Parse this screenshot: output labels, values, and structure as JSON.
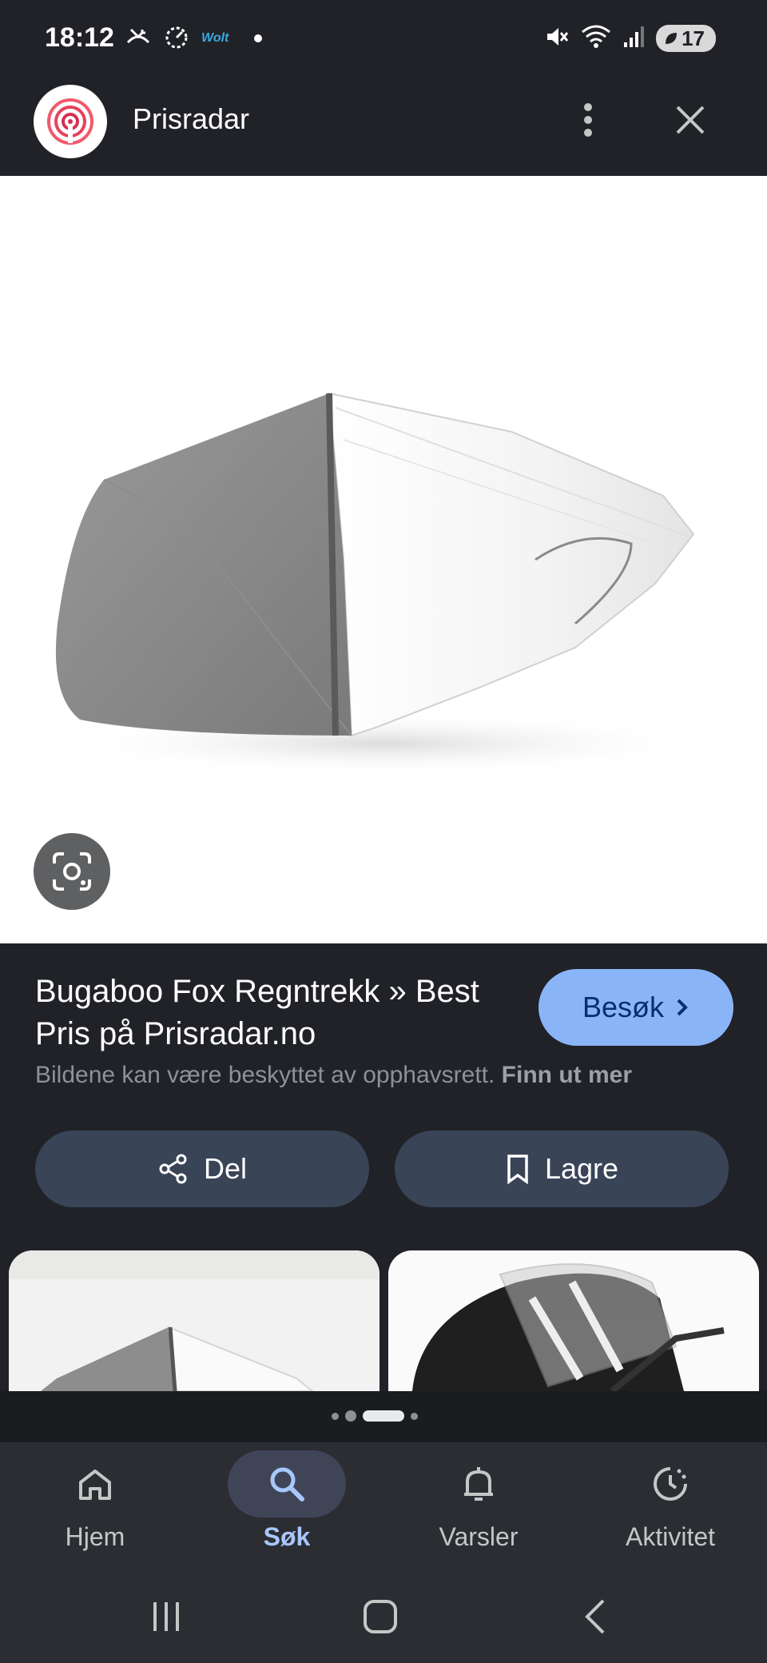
{
  "status_bar": {
    "time": "18:12",
    "left_icons": [
      "missed-call-icon",
      "timer-icon",
      "wolt-icon",
      "notification-dot"
    ],
    "wolt_label": "Wolt",
    "right_icons": [
      "mute-icon",
      "wifi-icon",
      "signal-icon"
    ],
    "battery": "17"
  },
  "header": {
    "app_name": "Prisradar",
    "more_icon": "more-vert-icon",
    "close_icon": "close-icon"
  },
  "result": {
    "title": "Bugaboo Fox Regntrekk » Best Pris på Prisradar.no",
    "visit_label": "Besøk",
    "copyright_text": "Bildene kan være beskyttet av opphavsrett.",
    "learn_more": "Finn ut mer",
    "share_label": "Del",
    "save_label": "Lagre"
  },
  "pager": {
    "count": 4,
    "active_index": 2
  },
  "bottom_nav": {
    "items": [
      {
        "label": "Hjem",
        "icon": "home-icon"
      },
      {
        "label": "Søk",
        "icon": "search-icon",
        "active": true
      },
      {
        "label": "Varsler",
        "icon": "bell-icon"
      },
      {
        "label": "Aktivitet",
        "icon": "activity-icon"
      }
    ]
  },
  "colors": {
    "background": "#202227",
    "accent": "#8ab4f8",
    "button_bg": "#394457",
    "nav_bg": "#2b2d33"
  }
}
